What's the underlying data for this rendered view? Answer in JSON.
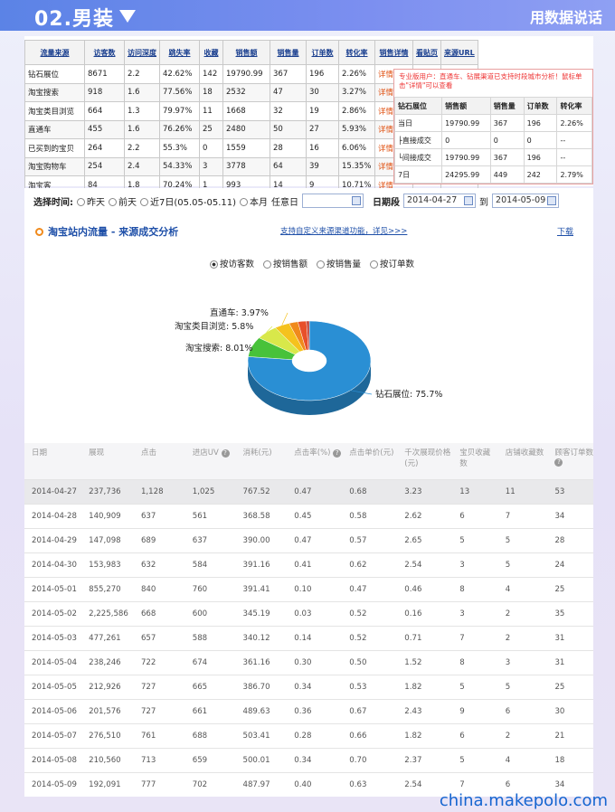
{
  "banner": {
    "title": "02.男装",
    "right_text": "用数据说话"
  },
  "traffic_table": {
    "headers": [
      "流量来源",
      "访客数",
      "访问深度",
      "跳失率",
      "收藏",
      "销售额",
      "销售量",
      "订单数",
      "转化率",
      "销售详情",
      "看贴页",
      "来源URL"
    ],
    "rows": [
      [
        "钻石展位",
        "8671",
        "2.2",
        "42.62%",
        "142",
        "19790.99",
        "367",
        "196",
        "2.26%",
        "详情"
      ],
      [
        "淘宝搜索",
        "918",
        "1.6",
        "77.56%",
        "18",
        "2532",
        "47",
        "30",
        "3.27%",
        "详情"
      ],
      [
        "淘宝类目浏览",
        "664",
        "1.3",
        "79.97%",
        "11",
        "1668",
        "32",
        "19",
        "2.86%",
        "详情"
      ],
      [
        "直通车",
        "455",
        "1.6",
        "76.26%",
        "25",
        "2480",
        "50",
        "27",
        "5.93%",
        "详情"
      ],
      [
        "已买到的宝贝",
        "264",
        "2.2",
        "55.3%",
        "0",
        "1559",
        "28",
        "16",
        "6.06%",
        "详情"
      ],
      [
        "淘宝购物车",
        "254",
        "2.4",
        "54.33%",
        "3",
        "3778",
        "64",
        "39",
        "15.35%",
        "详情"
      ],
      [
        "淘宝客",
        "84",
        "1.8",
        "70.24%",
        "1",
        "993",
        "14",
        "9",
        "10.71%",
        "详情"
      ]
    ]
  },
  "popup": {
    "note": "专业版用户：直通车、钻展渠道已支持时段城市分析！鼠标单击\"详情\"可以查看",
    "headers": [
      "钻石展位",
      "销售额",
      "销售量",
      "订单数",
      "转化率"
    ],
    "rows": [
      [
        "当日",
        "19790.99",
        "367",
        "196",
        "2.26%"
      ],
      [
        "├直接成交",
        "0",
        "0",
        "0",
        "--"
      ],
      [
        "└间接成交",
        "19790.99",
        "367",
        "196",
        "--"
      ],
      [
        "7日",
        "24295.99",
        "449",
        "242",
        "2.79%"
      ]
    ]
  },
  "controls": {
    "label": "选择时间:",
    "options": [
      "昨天",
      "前天",
      "近7日(05.05-05.11)",
      "本月"
    ],
    "custom_label": "任意日",
    "range_label": "日期段",
    "start_date": "2014-04-27",
    "to_label": "到",
    "end_date": "2014-05-09"
  },
  "chart_panel": {
    "title": "淘宝站内流量 - 来源成交分析",
    "link": "支持自定义来源渠道功能，详见>>>",
    "download": "下载",
    "metric_options": [
      "按访客数",
      "按销售额",
      "按销售量",
      "按订单数"
    ],
    "selected_metric": "按访客数"
  },
  "chart_data": {
    "type": "pie",
    "title": "",
    "labels": [
      "钻石展位",
      "淘宝搜索",
      "淘宝类目浏览",
      "直通车",
      "已买到的宝贝",
      "淘宝购物车",
      "淘宝客"
    ],
    "values": [
      75.7,
      8.01,
      5.8,
      3.97,
      2.31,
      2.22,
      0.73
    ],
    "label_text": [
      "钻石展位: 75.7%",
      "淘宝搜索: 8.01%",
      "淘宝类目浏览: 5.8%",
      "直通车: 3.97%"
    ],
    "colors": [
      "#2a8fd4",
      "#48c23a",
      "#d8e84a",
      "#f5c21e",
      "#f08a1c",
      "#e8502a",
      "#c0392b"
    ]
  },
  "daily_table": {
    "headers": [
      "日期",
      "展现",
      "点击",
      "进店UV",
      "消耗(元)",
      "点击率(%)",
      "点击单价(元)",
      "千次展现价格(元)",
      "宝贝收藏数",
      "店铺收藏数",
      "顾客订单数"
    ],
    "help_cols": [
      3,
      5,
      10
    ],
    "rows": [
      [
        "2014-04-27",
        "237,736",
        "1,128",
        "1,025",
        "767.52",
        "0.47",
        "0.68",
        "3.23",
        "13",
        "11",
        "53"
      ],
      [
        "2014-04-28",
        "140,909",
        "637",
        "561",
        "368.58",
        "0.45",
        "0.58",
        "2.62",
        "6",
        "7",
        "34"
      ],
      [
        "2014-04-29",
        "147,098",
        "689",
        "637",
        "390.00",
        "0.47",
        "0.57",
        "2.65",
        "5",
        "5",
        "28"
      ],
      [
        "2014-04-30",
        "153,983",
        "632",
        "584",
        "391.16",
        "0.41",
        "0.62",
        "2.54",
        "3",
        "5",
        "24"
      ],
      [
        "2014-05-01",
        "855,270",
        "840",
        "760",
        "391.41",
        "0.10",
        "0.47",
        "0.46",
        "8",
        "4",
        "25"
      ],
      [
        "2014-05-02",
        "2,225,586",
        "668",
        "600",
        "345.19",
        "0.03",
        "0.52",
        "0.16",
        "3",
        "2",
        "35"
      ],
      [
        "2014-05-03",
        "477,261",
        "657",
        "588",
        "340.12",
        "0.14",
        "0.52",
        "0.71",
        "7",
        "2",
        "31"
      ],
      [
        "2014-05-04",
        "238,246",
        "722",
        "674",
        "361.16",
        "0.30",
        "0.50",
        "1.52",
        "8",
        "3",
        "31"
      ],
      [
        "2014-05-05",
        "212,926",
        "727",
        "665",
        "386.70",
        "0.34",
        "0.53",
        "1.82",
        "5",
        "5",
        "25"
      ],
      [
        "2014-05-06",
        "201,576",
        "727",
        "661",
        "489.63",
        "0.36",
        "0.67",
        "2.43",
        "9",
        "6",
        "30"
      ],
      [
        "2014-05-07",
        "276,510",
        "761",
        "688",
        "503.41",
        "0.28",
        "0.66",
        "1.82",
        "6",
        "2",
        "21"
      ],
      [
        "2014-05-08",
        "210,560",
        "713",
        "659",
        "500.01",
        "0.34",
        "0.70",
        "2.37",
        "5",
        "4",
        "18"
      ],
      [
        "2014-05-09",
        "192,091",
        "777",
        "702",
        "487.97",
        "0.40",
        "0.63",
        "2.54",
        "7",
        "6",
        "34"
      ]
    ]
  },
  "watermark": "china.makepolo.com"
}
